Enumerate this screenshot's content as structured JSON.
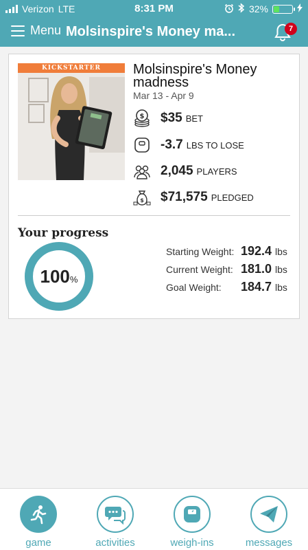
{
  "status_bar": {
    "carrier": "Verizon",
    "network": "LTE",
    "time": "8:31 PM",
    "battery": "32%",
    "battery_level": 0.32,
    "signal_bars": 4
  },
  "nav": {
    "menu_label": "Menu",
    "title": "Molsinspire's Money ma...",
    "notification_count": "7"
  },
  "game": {
    "banner": "KICKSTARTER",
    "title": "Molsinspire's Money madness",
    "dates": "Mar 13 - Apr 9",
    "stats": [
      {
        "icon": "coins-icon",
        "value": "$35",
        "label": "BET"
      },
      {
        "icon": "scale-icon",
        "value": "-3.7",
        "label": "LBS TO LOSE"
      },
      {
        "icon": "players-icon",
        "value": "2,045",
        "label": "PLAYERS"
      },
      {
        "icon": "money-bag-icon",
        "value": "$71,575",
        "label": "PLEDGED"
      }
    ]
  },
  "progress": {
    "title": "Your progress",
    "percent": "100",
    "percent_sign": "%",
    "fraction": 1.0,
    "weights": [
      {
        "label": "Starting Weight:",
        "value": "192.4",
        "unit": "lbs"
      },
      {
        "label": "Current Weight:",
        "value": "181.0",
        "unit": "lbs"
      },
      {
        "label": "Goal Weight:",
        "value": "184.7",
        "unit": "lbs"
      }
    ]
  },
  "tabs": [
    {
      "icon": "running-person-icon",
      "label": "game",
      "active": true
    },
    {
      "icon": "chat-bubbles-icon",
      "label": "activities",
      "active": false
    },
    {
      "icon": "scale-icon",
      "label": "weigh-ins",
      "active": false
    },
    {
      "icon": "paper-plane-icon",
      "label": "messages",
      "active": false
    }
  ],
  "colors": {
    "accent": "#4fa8b5",
    "kickstarter": "#f07d3a",
    "badge": "#d0021b",
    "battery": "#5ee25e"
  }
}
